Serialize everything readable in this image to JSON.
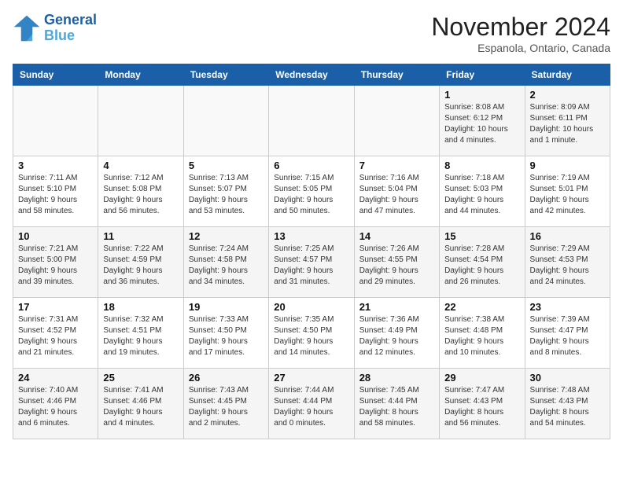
{
  "logo": {
    "line1": "General",
    "line2": "Blue"
  },
  "header": {
    "title": "November 2024",
    "location": "Espanola, Ontario, Canada"
  },
  "weekdays": [
    "Sunday",
    "Monday",
    "Tuesday",
    "Wednesday",
    "Thursday",
    "Friday",
    "Saturday"
  ],
  "weeks": [
    [
      {
        "day": "",
        "info": ""
      },
      {
        "day": "",
        "info": ""
      },
      {
        "day": "",
        "info": ""
      },
      {
        "day": "",
        "info": ""
      },
      {
        "day": "",
        "info": ""
      },
      {
        "day": "1",
        "info": "Sunrise: 8:08 AM\nSunset: 6:12 PM\nDaylight: 10 hours\nand 4 minutes."
      },
      {
        "day": "2",
        "info": "Sunrise: 8:09 AM\nSunset: 6:11 PM\nDaylight: 10 hours\nand 1 minute."
      }
    ],
    [
      {
        "day": "3",
        "info": "Sunrise: 7:11 AM\nSunset: 5:10 PM\nDaylight: 9 hours\nand 58 minutes."
      },
      {
        "day": "4",
        "info": "Sunrise: 7:12 AM\nSunset: 5:08 PM\nDaylight: 9 hours\nand 56 minutes."
      },
      {
        "day": "5",
        "info": "Sunrise: 7:13 AM\nSunset: 5:07 PM\nDaylight: 9 hours\nand 53 minutes."
      },
      {
        "day": "6",
        "info": "Sunrise: 7:15 AM\nSunset: 5:05 PM\nDaylight: 9 hours\nand 50 minutes."
      },
      {
        "day": "7",
        "info": "Sunrise: 7:16 AM\nSunset: 5:04 PM\nDaylight: 9 hours\nand 47 minutes."
      },
      {
        "day": "8",
        "info": "Sunrise: 7:18 AM\nSunset: 5:03 PM\nDaylight: 9 hours\nand 44 minutes."
      },
      {
        "day": "9",
        "info": "Sunrise: 7:19 AM\nSunset: 5:01 PM\nDaylight: 9 hours\nand 42 minutes."
      }
    ],
    [
      {
        "day": "10",
        "info": "Sunrise: 7:21 AM\nSunset: 5:00 PM\nDaylight: 9 hours\nand 39 minutes."
      },
      {
        "day": "11",
        "info": "Sunrise: 7:22 AM\nSunset: 4:59 PM\nDaylight: 9 hours\nand 36 minutes."
      },
      {
        "day": "12",
        "info": "Sunrise: 7:24 AM\nSunset: 4:58 PM\nDaylight: 9 hours\nand 34 minutes."
      },
      {
        "day": "13",
        "info": "Sunrise: 7:25 AM\nSunset: 4:57 PM\nDaylight: 9 hours\nand 31 minutes."
      },
      {
        "day": "14",
        "info": "Sunrise: 7:26 AM\nSunset: 4:55 PM\nDaylight: 9 hours\nand 29 minutes."
      },
      {
        "day": "15",
        "info": "Sunrise: 7:28 AM\nSunset: 4:54 PM\nDaylight: 9 hours\nand 26 minutes."
      },
      {
        "day": "16",
        "info": "Sunrise: 7:29 AM\nSunset: 4:53 PM\nDaylight: 9 hours\nand 24 minutes."
      }
    ],
    [
      {
        "day": "17",
        "info": "Sunrise: 7:31 AM\nSunset: 4:52 PM\nDaylight: 9 hours\nand 21 minutes."
      },
      {
        "day": "18",
        "info": "Sunrise: 7:32 AM\nSunset: 4:51 PM\nDaylight: 9 hours\nand 19 minutes."
      },
      {
        "day": "19",
        "info": "Sunrise: 7:33 AM\nSunset: 4:50 PM\nDaylight: 9 hours\nand 17 minutes."
      },
      {
        "day": "20",
        "info": "Sunrise: 7:35 AM\nSunset: 4:50 PM\nDaylight: 9 hours\nand 14 minutes."
      },
      {
        "day": "21",
        "info": "Sunrise: 7:36 AM\nSunset: 4:49 PM\nDaylight: 9 hours\nand 12 minutes."
      },
      {
        "day": "22",
        "info": "Sunrise: 7:38 AM\nSunset: 4:48 PM\nDaylight: 9 hours\nand 10 minutes."
      },
      {
        "day": "23",
        "info": "Sunrise: 7:39 AM\nSunset: 4:47 PM\nDaylight: 9 hours\nand 8 minutes."
      }
    ],
    [
      {
        "day": "24",
        "info": "Sunrise: 7:40 AM\nSunset: 4:46 PM\nDaylight: 9 hours\nand 6 minutes."
      },
      {
        "day": "25",
        "info": "Sunrise: 7:41 AM\nSunset: 4:46 PM\nDaylight: 9 hours\nand 4 minutes."
      },
      {
        "day": "26",
        "info": "Sunrise: 7:43 AM\nSunset: 4:45 PM\nDaylight: 9 hours\nand 2 minutes."
      },
      {
        "day": "27",
        "info": "Sunrise: 7:44 AM\nSunset: 4:44 PM\nDaylight: 9 hours\nand 0 minutes."
      },
      {
        "day": "28",
        "info": "Sunrise: 7:45 AM\nSunset: 4:44 PM\nDaylight: 8 hours\nand 58 minutes."
      },
      {
        "day": "29",
        "info": "Sunrise: 7:47 AM\nSunset: 4:43 PM\nDaylight: 8 hours\nand 56 minutes."
      },
      {
        "day": "30",
        "info": "Sunrise: 7:48 AM\nSunset: 4:43 PM\nDaylight: 8 hours\nand 54 minutes."
      }
    ]
  ]
}
